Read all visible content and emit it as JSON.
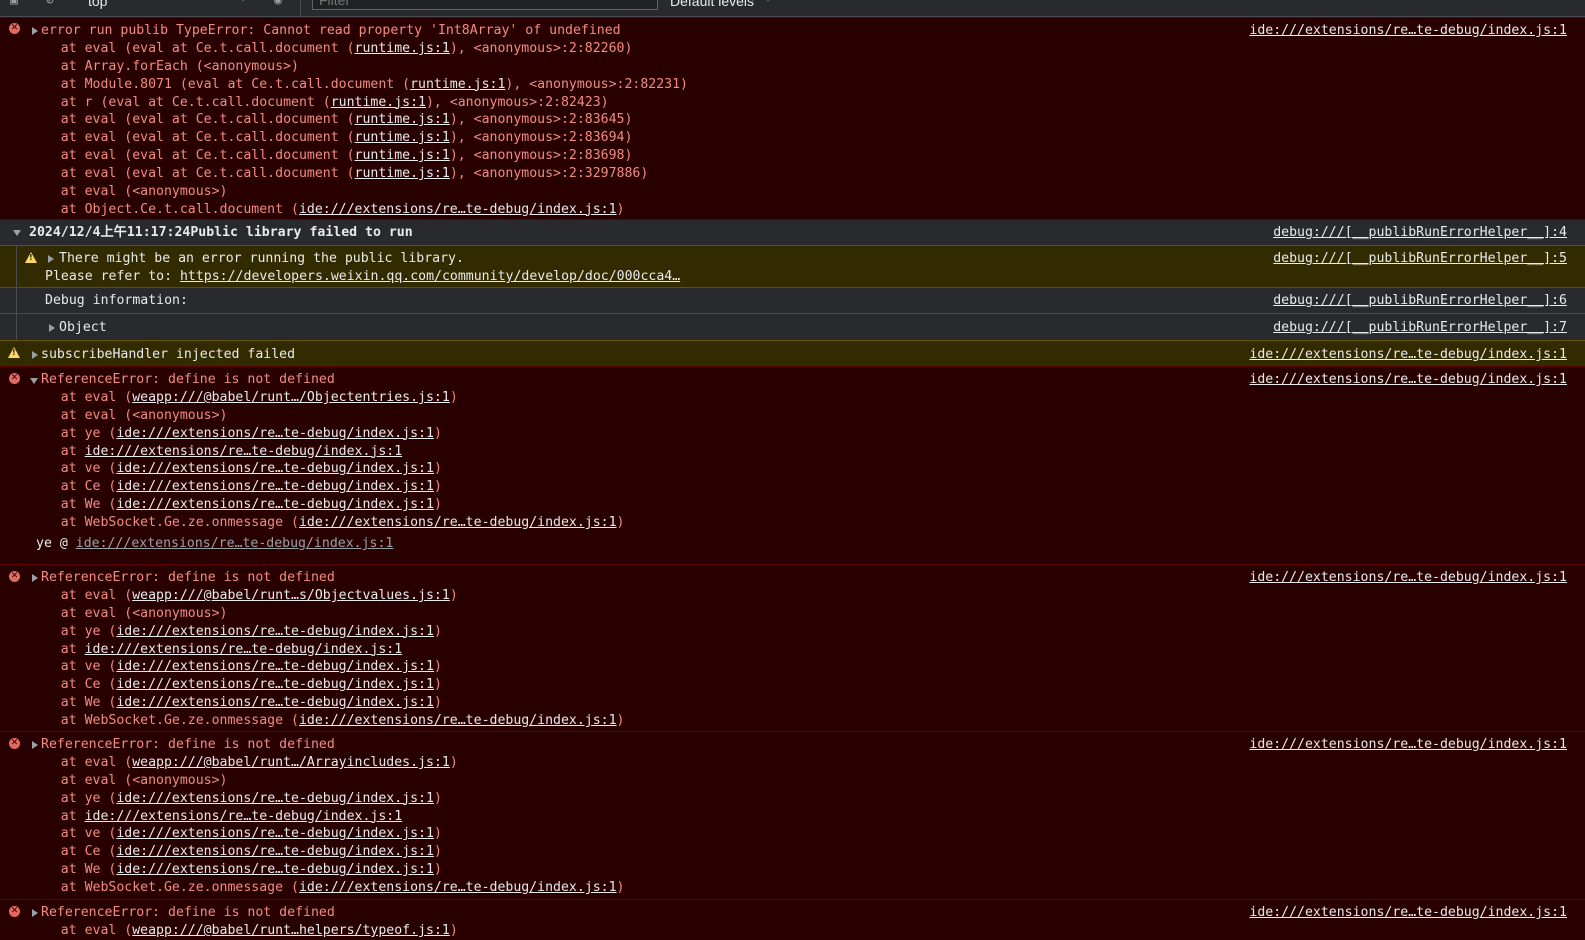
{
  "toolbar": {
    "context": "top",
    "filter_placeholder": "Filter",
    "levels": "Default levels"
  },
  "messages": [
    {
      "header": "error run publib TypeError: Cannot read property 'Int8Array' of undefined",
      "source": "ide:///extensions/re…te-debug/index.js:1",
      "frames": [
        {
          "pre": "    at eval (eval at Ce.t.call.document (",
          "link": "runtime.js:1",
          "post": "), <anonymous>:2:82260)"
        },
        {
          "pre": "    at Array.forEach (<anonymous>)",
          "link": "",
          "post": ""
        },
        {
          "pre": "    at Module.8071 (eval at Ce.t.call.document (",
          "link": "runtime.js:1",
          "post": "), <anonymous>:2:82231)"
        },
        {
          "pre": "    at r (eval at Ce.t.call.document (",
          "link": "runtime.js:1",
          "post": "), <anonymous>:2:82423)"
        },
        {
          "pre": "    at eval (eval at Ce.t.call.document (",
          "link": "runtime.js:1",
          "post": "), <anonymous>:2:83645)"
        },
        {
          "pre": "    at eval (eval at Ce.t.call.document (",
          "link": "runtime.js:1",
          "post": "), <anonymous>:2:83694)"
        },
        {
          "pre": "    at eval (eval at Ce.t.call.document (",
          "link": "runtime.js:1",
          "post": "), <anonymous>:2:83698)"
        },
        {
          "pre": "    at eval (eval at Ce.t.call.document (",
          "link": "runtime.js:1",
          "post": "), <anonymous>:2:3297886)"
        },
        {
          "pre": "    at eval (<anonymous>)",
          "link": "",
          "post": ""
        },
        {
          "pre": "    at Object.Ce.t.call.document (",
          "link": "ide:///extensions/re…te-debug/index.js:1",
          "post": ")"
        }
      ]
    },
    {
      "group_title": "2024/12/4上午11:17:24Public library failed to run",
      "group_source": "debug:///[__publibRunErrorHelper__]:4",
      "warn_line1": "There might be an error running the public library.",
      "warn_line2_pre": "Please refer to: ",
      "warn_line2_link": "https://developers.weixin.qq.com/community/develop/doc/000cca4…",
      "warn_source": "debug:///[__publibRunErrorHelper__]:5",
      "debug_info": "Debug information:",
      "debug_source": "debug:///[__publibRunErrorHelper__]:6",
      "object_label": "Object",
      "object_source": "debug:///[__publibRunErrorHelper__]:7"
    },
    {
      "warn_text": "subscribeHandler injected failed",
      "source": "ide:///extensions/re…te-debug/index.js:1"
    },
    {
      "header": "ReferenceError: define is not defined",
      "source": "ide:///extensions/re…te-debug/index.js:1",
      "frames": [
        {
          "pre": "    at eval (",
          "link": "weapp:///@babel/runt…/Objectentries.js:1",
          "post": ")"
        },
        {
          "pre": "    at eval (<anonymous>)",
          "link": "",
          "post": ""
        },
        {
          "pre": "    at ye (",
          "link": "ide:///extensions/re…te-debug/index.js:1",
          "post": ")"
        },
        {
          "pre": "    at ",
          "link": "ide:///extensions/re…te-debug/index.js:1",
          "post": ""
        },
        {
          "pre": "    at ve (",
          "link": "ide:///extensions/re…te-debug/index.js:1",
          "post": ")"
        },
        {
          "pre": "    at Ce (",
          "link": "ide:///extensions/re…te-debug/index.js:1",
          "post": ")"
        },
        {
          "pre": "    at We (",
          "link": "ide:///extensions/re…te-debug/index.js:1",
          "post": ")"
        },
        {
          "pre": "    at WebSocket.Ge.ze.onmessage (",
          "link": "ide:///extensions/re…te-debug/index.js:1",
          "post": ")"
        }
      ],
      "stack_fn": "ye",
      "stack_at": "@",
      "stack_link": "ide:///extensions/re…te-debug/index.js:1"
    },
    {
      "header": "ReferenceError: define is not defined",
      "source": "ide:///extensions/re…te-debug/index.js:1",
      "frames": [
        {
          "pre": "    at eval (",
          "link": "weapp:///@babel/runt…s/Objectvalues.js:1",
          "post": ")"
        },
        {
          "pre": "    at eval (<anonymous>)",
          "link": "",
          "post": ""
        },
        {
          "pre": "    at ye (",
          "link": "ide:///extensions/re…te-debug/index.js:1",
          "post": ")"
        },
        {
          "pre": "    at ",
          "link": "ide:///extensions/re…te-debug/index.js:1",
          "post": ""
        },
        {
          "pre": "    at ve (",
          "link": "ide:///extensions/re…te-debug/index.js:1",
          "post": ")"
        },
        {
          "pre": "    at Ce (",
          "link": "ide:///extensions/re…te-debug/index.js:1",
          "post": ")"
        },
        {
          "pre": "    at We (",
          "link": "ide:///extensions/re…te-debug/index.js:1",
          "post": ")"
        },
        {
          "pre": "    at WebSocket.Ge.ze.onmessage (",
          "link": "ide:///extensions/re…te-debug/index.js:1",
          "post": ")"
        }
      ]
    },
    {
      "header": "ReferenceError: define is not defined",
      "source": "ide:///extensions/re…te-debug/index.js:1",
      "frames": [
        {
          "pre": "    at eval (",
          "link": "weapp:///@babel/runt…/Arrayincludes.js:1",
          "post": ")"
        },
        {
          "pre": "    at eval (<anonymous>)",
          "link": "",
          "post": ""
        },
        {
          "pre": "    at ye (",
          "link": "ide:///extensions/re…te-debug/index.js:1",
          "post": ")"
        },
        {
          "pre": "    at ",
          "link": "ide:///extensions/re…te-debug/index.js:1",
          "post": ""
        },
        {
          "pre": "    at ve (",
          "link": "ide:///extensions/re…te-debug/index.js:1",
          "post": ")"
        },
        {
          "pre": "    at Ce (",
          "link": "ide:///extensions/re…te-debug/index.js:1",
          "post": ")"
        },
        {
          "pre": "    at We (",
          "link": "ide:///extensions/re…te-debug/index.js:1",
          "post": ")"
        },
        {
          "pre": "    at WebSocket.Ge.ze.onmessage (",
          "link": "ide:///extensions/re…te-debug/index.js:1",
          "post": ")"
        }
      ]
    },
    {
      "header": "ReferenceError: define is not defined",
      "source": "ide:///extensions/re…te-debug/index.js:1",
      "frames": [
        {
          "pre": "    at eval (",
          "link": "weapp:///@babel/runt…helpers/typeof.js:1",
          "post": ")"
        }
      ]
    }
  ]
}
